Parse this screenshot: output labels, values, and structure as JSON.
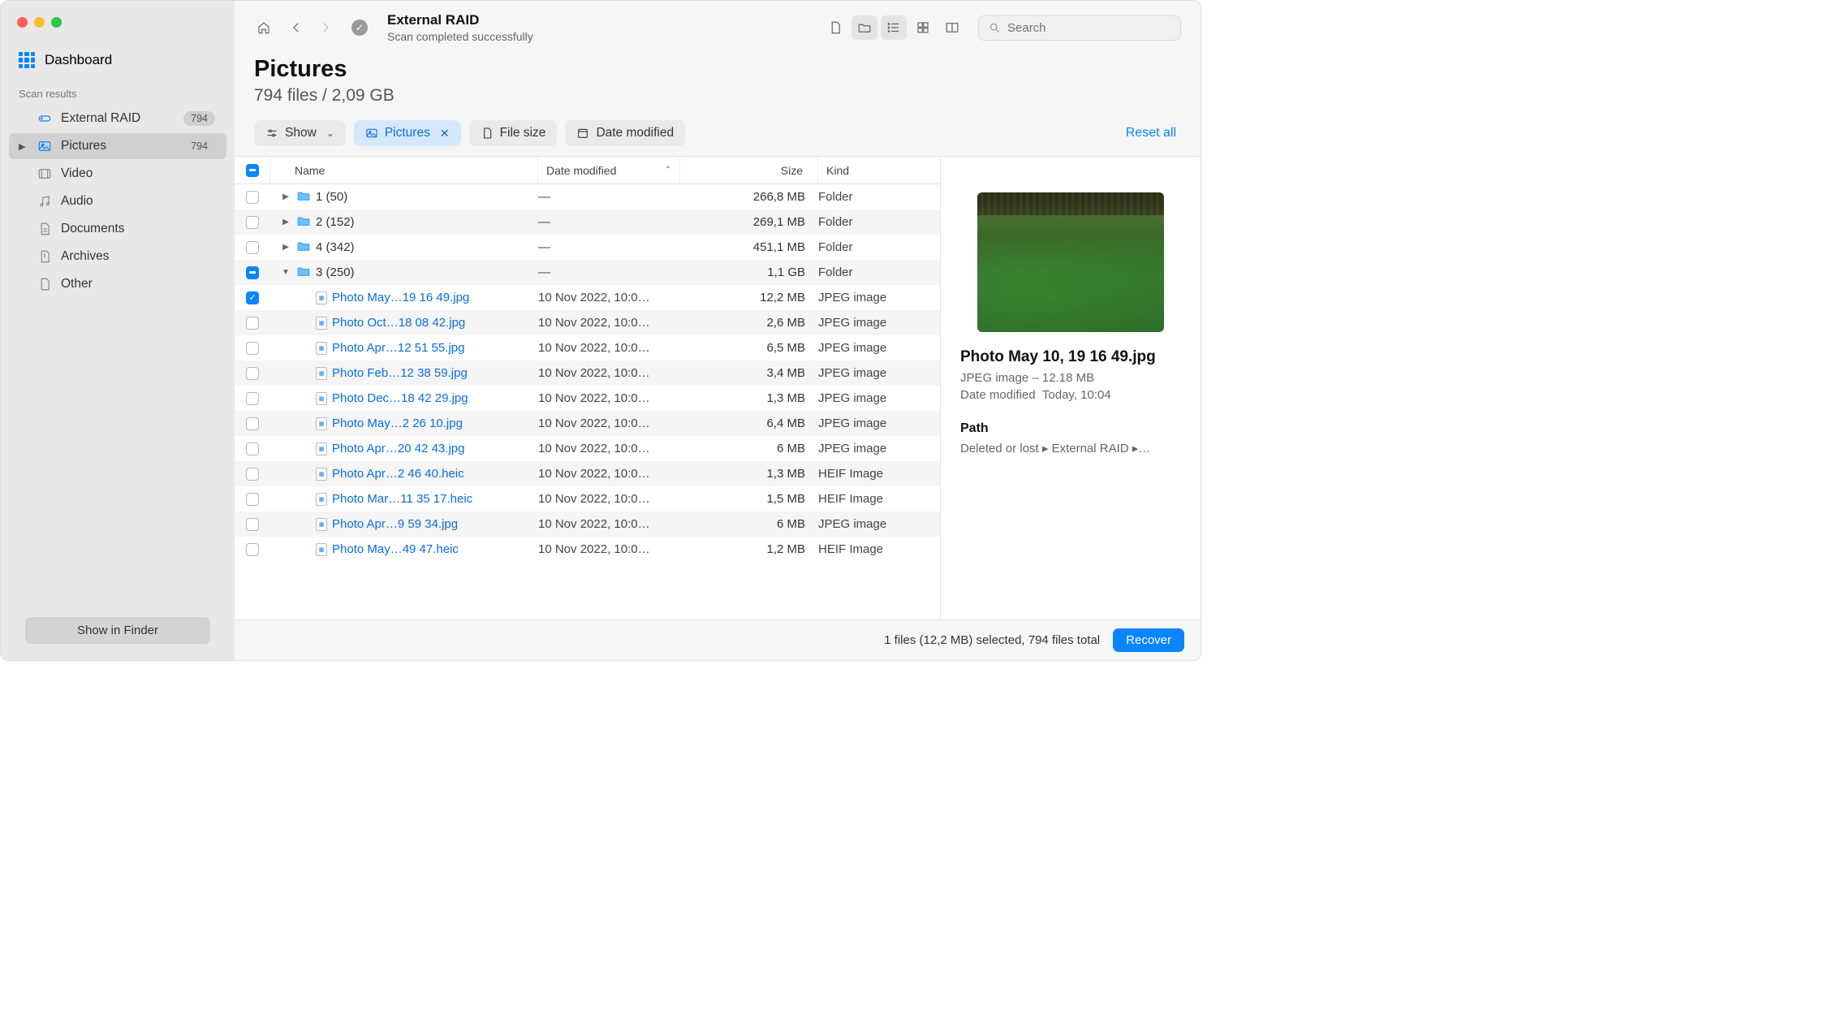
{
  "sidebar": {
    "dashboard_label": "Dashboard",
    "section_label": "Scan results",
    "items": [
      {
        "label": "External RAID",
        "badge": "794"
      },
      {
        "label": "Pictures",
        "badge": "794"
      },
      {
        "label": "Video"
      },
      {
        "label": "Audio"
      },
      {
        "label": "Documents"
      },
      {
        "label": "Archives"
      },
      {
        "label": "Other"
      }
    ],
    "show_in_finder": "Show in Finder"
  },
  "toolbar": {
    "title": "External RAID",
    "subtitle": "Scan completed successfully",
    "search_placeholder": "Search"
  },
  "header": {
    "title": "Pictures",
    "subtitle": "794 files / 2,09 GB"
  },
  "filters": {
    "show_label": "Show",
    "pictures_label": "Pictures",
    "filesize_label": "File size",
    "datemod_label": "Date modified",
    "reset_label": "Reset all"
  },
  "columns": {
    "name": "Name",
    "date": "Date modified",
    "size": "Size",
    "kind": "Kind"
  },
  "rows": [
    {
      "type": "folder",
      "depth": 0,
      "expanded": false,
      "checked": "none",
      "name": "1 (50)",
      "date": "—",
      "size": "266,8 MB",
      "kind": "Folder"
    },
    {
      "type": "folder",
      "depth": 0,
      "expanded": false,
      "checked": "none",
      "name": "2 (152)",
      "date": "—",
      "size": "269,1 MB",
      "kind": "Folder"
    },
    {
      "type": "folder",
      "depth": 0,
      "expanded": false,
      "checked": "none",
      "name": "4 (342)",
      "date": "—",
      "size": "451,1 MB",
      "kind": "Folder"
    },
    {
      "type": "folder",
      "depth": 0,
      "expanded": true,
      "checked": "mixed",
      "name": "3 (250)",
      "date": "—",
      "size": "1,1 GB",
      "kind": "Folder"
    },
    {
      "type": "file",
      "depth": 1,
      "checked": "checked",
      "name": "Photo May…19 16 49.jpg",
      "date": "10 Nov 2022, 10:0…",
      "size": "12,2 MB",
      "kind": "JPEG image"
    },
    {
      "type": "file",
      "depth": 1,
      "checked": "none",
      "name": "Photo Oct…18 08 42.jpg",
      "date": "10 Nov 2022, 10:0…",
      "size": "2,6 MB",
      "kind": "JPEG image"
    },
    {
      "type": "file",
      "depth": 1,
      "checked": "none",
      "name": "Photo Apr…12 51 55.jpg",
      "date": "10 Nov 2022, 10:0…",
      "size": "6,5 MB",
      "kind": "JPEG image"
    },
    {
      "type": "file",
      "depth": 1,
      "checked": "none",
      "name": "Photo Feb…12 38 59.jpg",
      "date": "10 Nov 2022, 10:0…",
      "size": "3,4 MB",
      "kind": "JPEG image"
    },
    {
      "type": "file",
      "depth": 1,
      "checked": "none",
      "name": "Photo Dec…18 42 29.jpg",
      "date": "10 Nov 2022, 10:0…",
      "size": "1,3 MB",
      "kind": "JPEG image"
    },
    {
      "type": "file",
      "depth": 1,
      "checked": "none",
      "name": "Photo May…2 26 10.jpg",
      "date": "10 Nov 2022, 10:0…",
      "size": "6,4 MB",
      "kind": "JPEG image"
    },
    {
      "type": "file",
      "depth": 1,
      "checked": "none",
      "name": "Photo Apr…20 42 43.jpg",
      "date": "10 Nov 2022, 10:0…",
      "size": "6 MB",
      "kind": "JPEG image"
    },
    {
      "type": "file",
      "depth": 1,
      "checked": "none",
      "name": "Photo Apr…2 46 40.heic",
      "date": "10 Nov 2022, 10:0…",
      "size": "1,3 MB",
      "kind": "HEIF Image"
    },
    {
      "type": "file",
      "depth": 1,
      "checked": "none",
      "name": "Photo Mar…11 35 17.heic",
      "date": "10 Nov 2022, 10:0…",
      "size": "1,5 MB",
      "kind": "HEIF Image"
    },
    {
      "type": "file",
      "depth": 1,
      "checked": "none",
      "name": "Photo Apr…9 59 34.jpg",
      "date": "10 Nov 2022, 10:0…",
      "size": "6 MB",
      "kind": "JPEG image"
    },
    {
      "type": "file",
      "depth": 1,
      "checked": "none",
      "name": "Photo May…49 47.heic",
      "date": "10 Nov 2022, 10:0…",
      "size": "1,2 MB",
      "kind": "HEIF Image"
    }
  ],
  "preview": {
    "title": "Photo May 10, 19 16 49.jpg",
    "kind_size": "JPEG image – 12.18 MB",
    "date_label": "Date modified",
    "date_value": "Today, 10:04",
    "path_heading": "Path",
    "path_value": "Deleted or lost ▸ External RAID ▸…"
  },
  "footer": {
    "status": "1 files (12,2 MB) selected, 794 files total",
    "recover_label": "Recover"
  }
}
